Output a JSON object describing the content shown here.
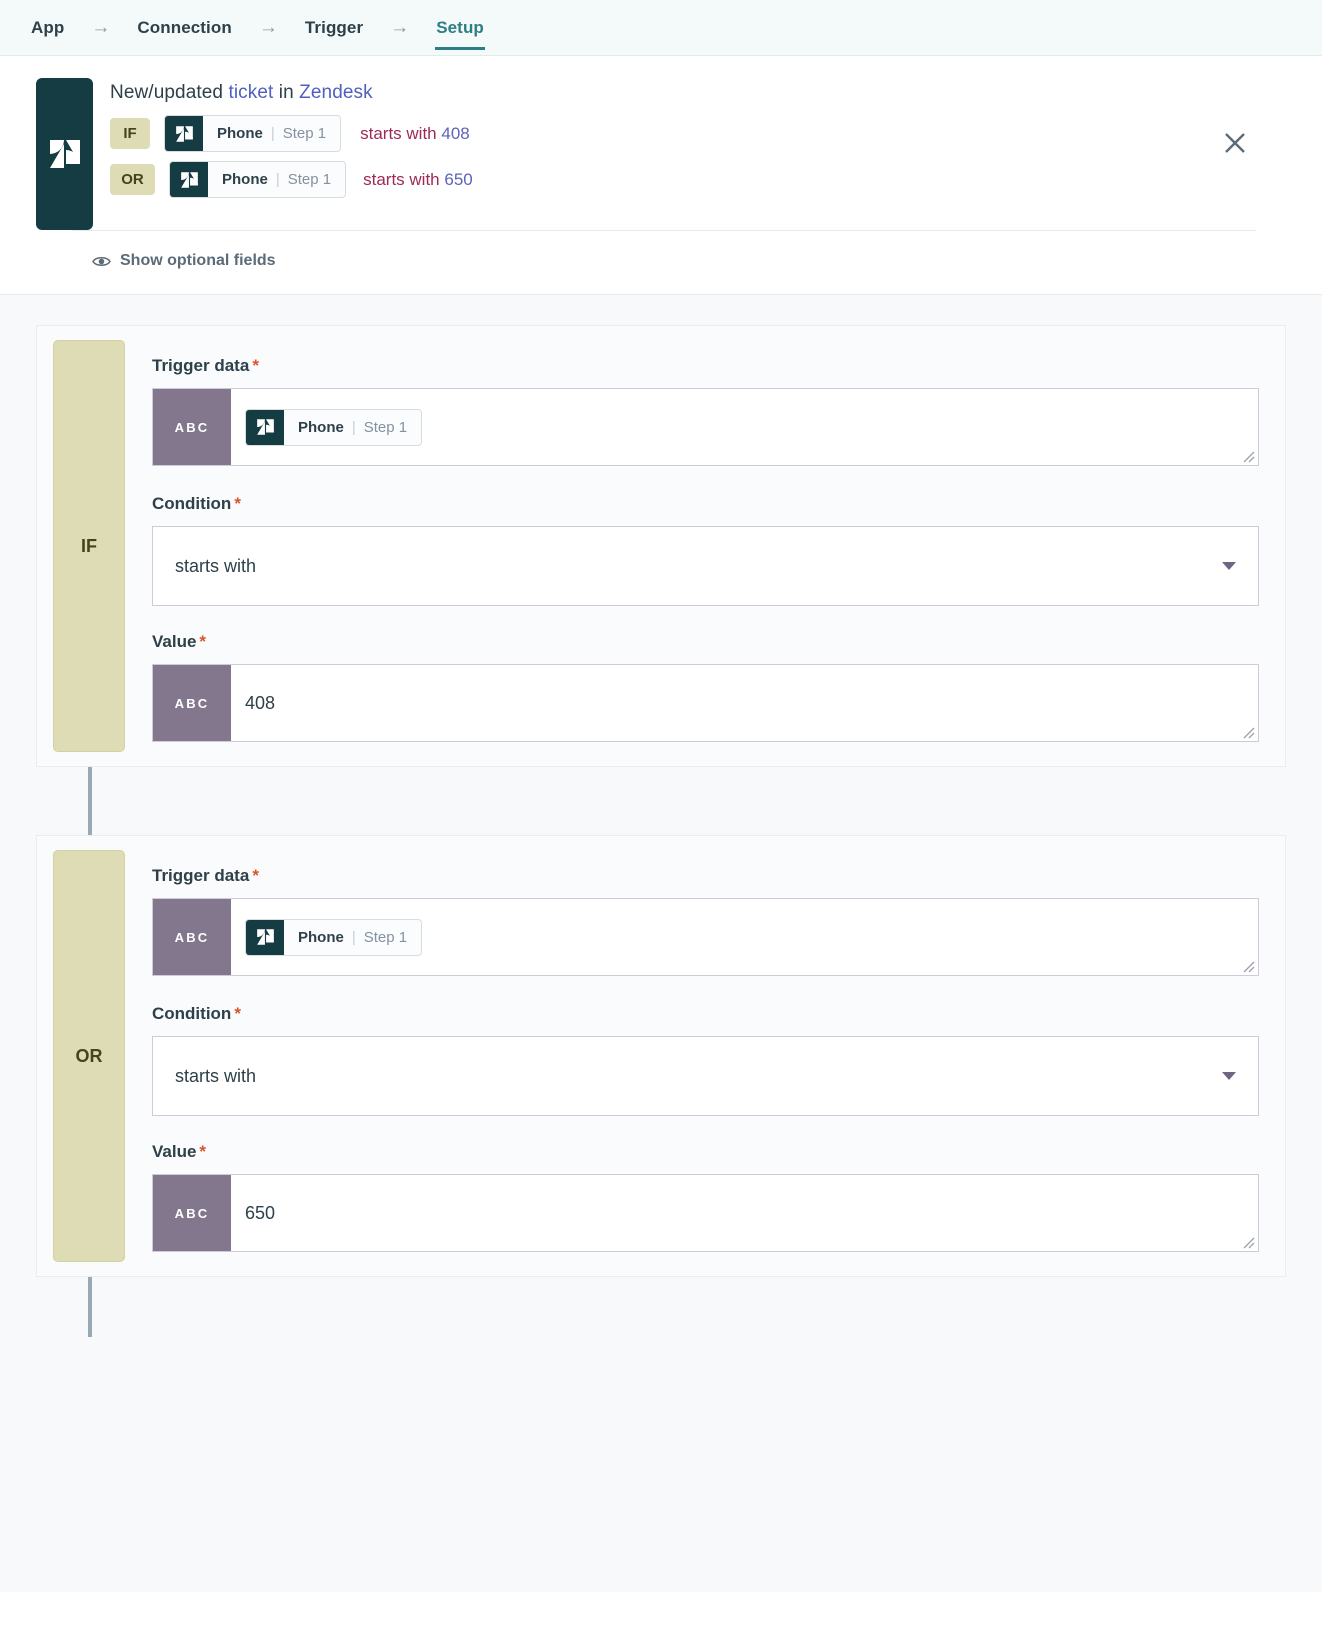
{
  "nav": {
    "items": [
      {
        "label": "App",
        "active": false
      },
      {
        "label": "Connection",
        "active": false
      },
      {
        "label": "Trigger",
        "active": false
      },
      {
        "label": "Setup",
        "active": true
      }
    ],
    "arrow": "→"
  },
  "header": {
    "app_icon": "zendesk-logo",
    "title_prefix": "New/updated ",
    "title_link_1": "ticket",
    "title_mid": " in ",
    "title_link_2": "Zendesk",
    "conditions": [
      {
        "logic": "IF",
        "token_field": "Phone",
        "token_step": "Step 1",
        "operator": "starts with",
        "value": "408"
      },
      {
        "logic": "OR",
        "token_field": "Phone",
        "token_step": "Step 1",
        "operator": "starts with",
        "value": "650"
      }
    ],
    "close_label": "close",
    "optional_fields_label": "Show optional fields",
    "eye_icon": "eye-icon"
  },
  "blocks": [
    {
      "logic": "IF",
      "trigger_data_label": "Trigger data",
      "trigger_data_badge": "ABC",
      "trigger_token_field": "Phone",
      "trigger_token_step": "Step 1",
      "condition_label": "Condition",
      "condition_value": "starts with",
      "value_label": "Value",
      "value_badge": "ABC",
      "value_text": "408",
      "required_marker": "*"
    },
    {
      "logic": "OR",
      "trigger_data_label": "Trigger data",
      "trigger_data_badge": "ABC",
      "trigger_token_field": "Phone",
      "trigger_token_step": "Step 1",
      "condition_label": "Condition",
      "condition_value": "starts with",
      "value_label": "Value",
      "value_badge": "ABC",
      "value_text": "650",
      "required_marker": "*"
    }
  ],
  "colors": {
    "brand_dark": "#163c43",
    "accent_teal": "#2b7f86",
    "logic_chip_bg": "#dedcb5",
    "abc_badge_bg": "#83778e",
    "operator_text": "#9d2a56",
    "value_text": "#5e62b8",
    "required_star": "#d9542b",
    "connector": "#97aab4"
  }
}
